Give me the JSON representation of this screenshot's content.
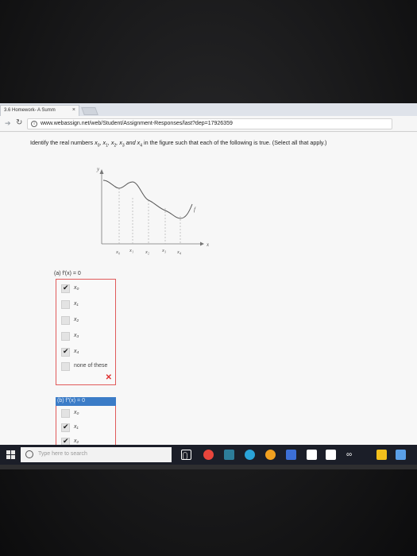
{
  "browser": {
    "tab_title": "3.6 Homework- A Summ",
    "tab_close": "×",
    "url": "www.webassign.net/web/Student/Assignment-Responses/last?dep=17926359"
  },
  "question": {
    "instructions_pre": "Identify the real numbers ",
    "instructions_post": " in the figure such that each of the following is true. (Select all that apply.)",
    "vars": [
      "x",
      "0",
      ", x",
      "1",
      ", x",
      "2",
      ", x",
      "3",
      " and x",
      "4"
    ]
  },
  "graph": {
    "y_label": "y",
    "x_label": "x",
    "curve_label": "f",
    "ticks": [
      "x₀",
      "x₁",
      "x₂",
      "x₃",
      "x₄"
    ]
  },
  "part_a": {
    "label": "(a)  f′(x) = 0",
    "options": [
      {
        "label": "x₀",
        "checked": true
      },
      {
        "label": "x₁",
        "checked": false
      },
      {
        "label": "x₂",
        "checked": false
      },
      {
        "label": "x₃",
        "checked": false
      },
      {
        "label": "x₄",
        "checked": true
      },
      {
        "label": "none of these",
        "checked": false
      }
    ],
    "result_mark": "✕"
  },
  "part_b": {
    "label": "(b)  f″(x) = 0",
    "options": [
      {
        "label": "x₀",
        "checked": false
      },
      {
        "label": "x₁",
        "checked": true
      },
      {
        "label": "x₂",
        "checked": true
      }
    ]
  },
  "taskbar": {
    "search_placeholder": "Type here to search",
    "icon_colors": [
      "#ffffff",
      "#e8453c",
      "#2d7d9a",
      "#2aa3d9",
      "#f0a020",
      "#3c6fd6",
      "#ffffff",
      "#ffffff",
      "#ffffff",
      "#f3c01c",
      "#5aa0e8"
    ]
  }
}
